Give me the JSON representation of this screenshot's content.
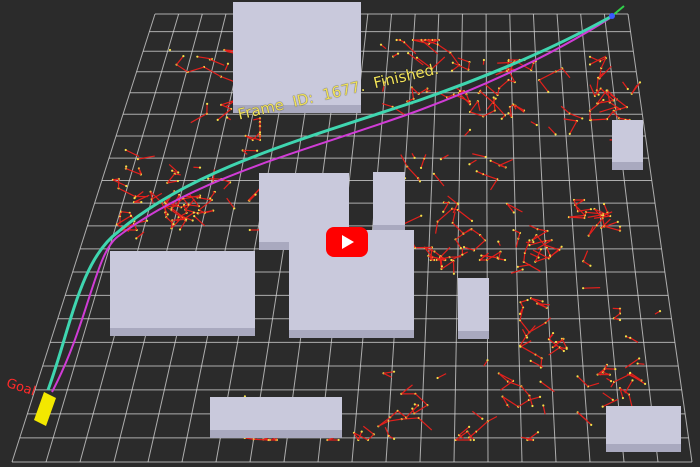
{
  "overlay": {
    "frame_text": "Frame  ID:  1677.  Finished.",
    "goal_label": "Goal"
  },
  "video": {
    "play_button": "play-icon"
  },
  "colors": {
    "background": "#2b2b2b",
    "grid": "#d9d9d9",
    "buildings": "#c9c9dc",
    "tree_edges": "#e3201c",
    "tree_nodes": "#f4e04a",
    "path_main": "#3fd6b0",
    "path_alt": "#d03cd6",
    "goal_marker": "#f3e800"
  }
}
